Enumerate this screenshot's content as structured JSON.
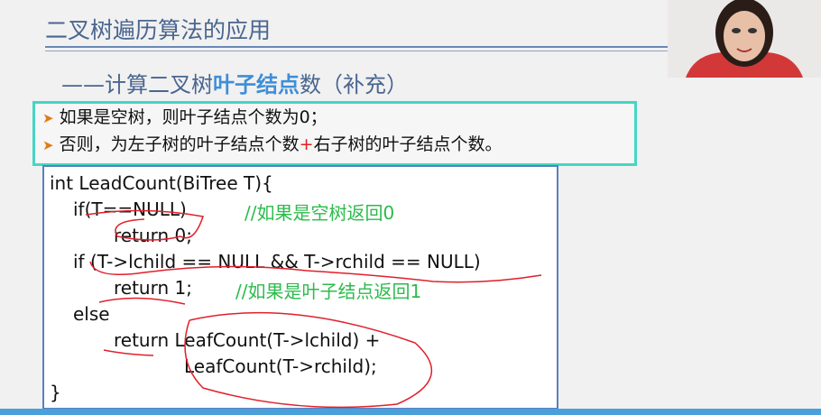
{
  "slide": {
    "title": "二叉树遍历算法的应用",
    "subtitle_prefix": "——计算二叉树",
    "subtitle_highlight": "叶子结点",
    "subtitle_suffix": "数（补充）",
    "bullets": [
      {
        "text": "如果是空树，则叶子结点个数为0；"
      },
      {
        "text_a": "否则，为左子树的叶子结点个数",
        "plus": "+",
        "text_b": "右子树的叶子结点个数。"
      }
    ],
    "code": {
      "lines": [
        "int LeadCount(BiTree T){",
        "if(T==NULL)",
        "return 0;",
        "if (T->lchild == NULL && T->rchild == NULL)",
        "return 1;",
        "else",
        "return LeafCount(T->lchild) +",
        "LeafCount(T->rchild);",
        "}"
      ],
      "comment1": "//如果是空树返回0",
      "comment2": "//如果是叶子结点返回1"
    }
  },
  "colors": {
    "title": "#4a6590",
    "highlight": "#3e8ed8",
    "border": "#45d6c4",
    "comment": "#2cbb4c",
    "annotation": "#e0202a"
  }
}
